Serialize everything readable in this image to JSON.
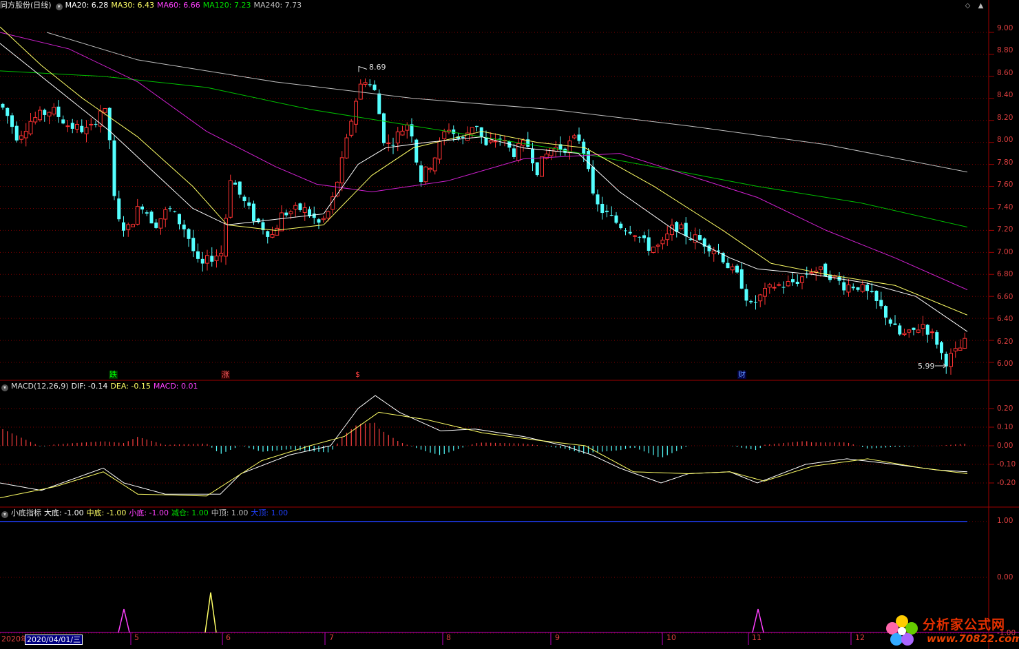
{
  "price_header": {
    "stock": "同方股份(日线)",
    "ma": [
      {
        "text": "MA20: 6.28",
        "color": "#ffffff"
      },
      {
        "text": "MA30: 6.43",
        "color": "#ffff66"
      },
      {
        "text": "MA60: 6.66",
        "color": "#ff40ff"
      },
      {
        "text": "MA120: 7.23",
        "color": "#00e000"
      },
      {
        "text": "MA240: 7.73",
        "color": "#c0c0c0"
      }
    ]
  },
  "price_axis": [
    "9.00",
    "8.80",
    "8.60",
    "8.40",
    "8.20",
    "8.00",
    "7.80",
    "7.60",
    "7.40",
    "7.20",
    "7.00",
    "6.80",
    "6.60",
    "6.40",
    "6.20",
    "6.00"
  ],
  "price_marks": {
    "high": "8.69",
    "low": "5.99"
  },
  "event_tags": [
    {
      "text": "跌",
      "color": "#00ff00",
      "bg": "#004000"
    },
    {
      "text": "涨",
      "color": "#ff6060",
      "bg": "#400000"
    },
    {
      "text": "$",
      "color": "#ff4040",
      "bg": "#000000"
    },
    {
      "text": "财",
      "color": "#6090ff",
      "bg": "#000040"
    }
  ],
  "macd_header": {
    "name": "MACD(12,26,9)",
    "dif": "DIF: -0.14",
    "dea": "DEA: -0.15",
    "macd": "MACD: 0.01"
  },
  "macd_axis": [
    "0.20",
    "0.10",
    "0.00",
    "-0.10",
    "-0.20"
  ],
  "ind_header": {
    "name": "小底指标",
    "items": [
      {
        "text": "大底: -1.00",
        "color": "#ffffff"
      },
      {
        "text": "中底: -1.00",
        "color": "#ffff66"
      },
      {
        "text": "小底: -1.00",
        "color": "#ff40ff"
      },
      {
        "text": "减仓: 1.00",
        "color": "#00e000"
      },
      {
        "text": "中顶: 1.00",
        "color": "#c0c0c0"
      },
      {
        "text": "大顶: 1.00",
        "color": "#2040ff"
      }
    ]
  },
  "ind_axis": [
    "1.00",
    "0.00",
    "-1.00"
  ],
  "x_axis": {
    "first": "2020年",
    "cursor_date": "2020/04/01/三",
    "months": [
      "5",
      "6",
      "7",
      "8",
      "9",
      "10",
      "11",
      "12"
    ]
  },
  "watermark": {
    "line1": "分析家公式网",
    "line2": "www.70822.com"
  },
  "colors": {
    "up": "#ff3232",
    "down": "#54ffff",
    "grid": "#800000",
    "border": "#a00000"
  },
  "chart_data": {
    "type": "candlestick",
    "title": "同方股份(日线)",
    "ylim": [
      5.9,
      9.1
    ],
    "high": 8.69,
    "low": 5.99,
    "last_ma": {
      "MA20": 6.28,
      "MA30": 6.43,
      "MA60": 6.66,
      "MA120": 7.23,
      "MA240": 7.73
    },
    "macd": {
      "DIF": -0.14,
      "DEA": -0.15,
      "MACD": 0.01,
      "ylim": [
        -0.3,
        0.3
      ]
    }
  }
}
